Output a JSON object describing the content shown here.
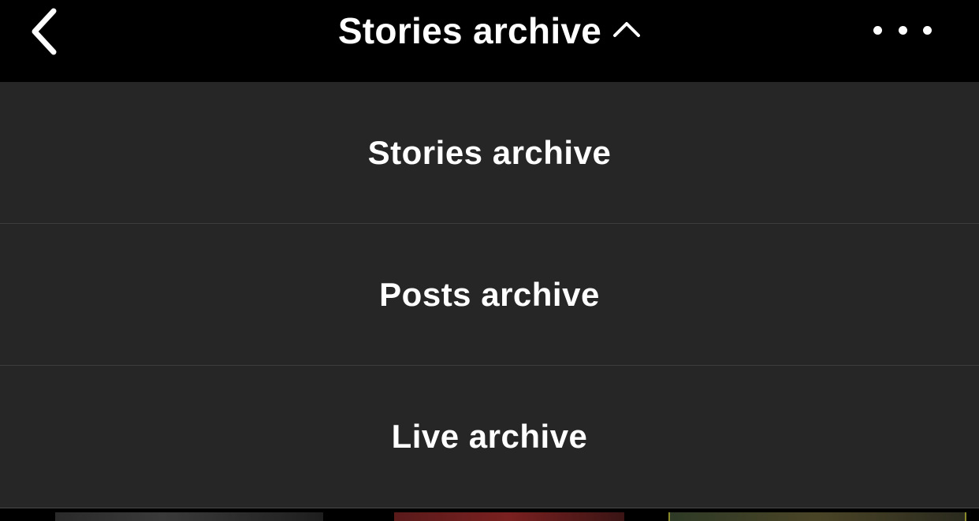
{
  "header": {
    "title": "Stories archive",
    "back_icon": "chevron-left-icon",
    "title_toggle_icon": "chevron-up-icon",
    "more_icon": "more-horizontal-icon"
  },
  "menu": {
    "items": [
      {
        "label": "Stories archive"
      },
      {
        "label": "Posts archive"
      },
      {
        "label": "Live archive"
      }
    ]
  },
  "colors": {
    "header_bg": "#000000",
    "menu_bg": "#262626",
    "divider": "#3d3d3d",
    "text": "#ffffff"
  }
}
